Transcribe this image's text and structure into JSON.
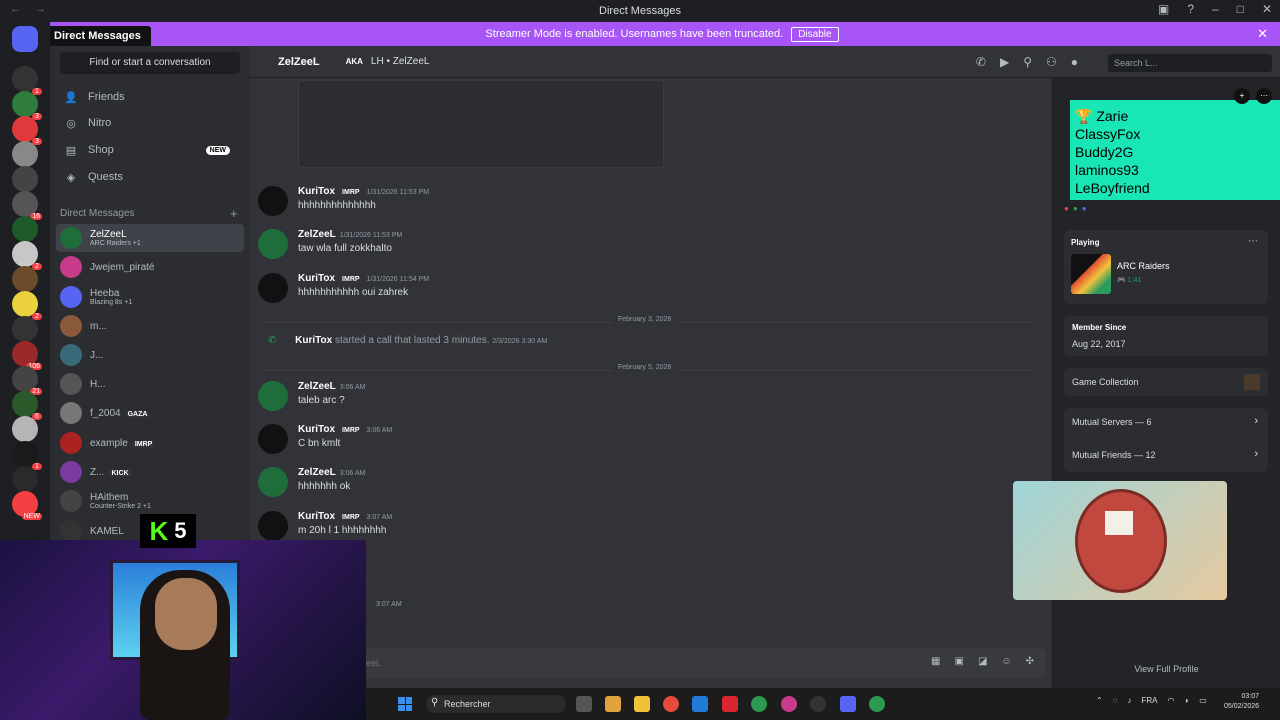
{
  "window": {
    "title": "Direct Messages"
  },
  "notice": {
    "text": "Streamer Mode is enabled. Usernames have been truncated.",
    "button": "Disable"
  },
  "tooltip": "Direct Messages",
  "sidebar": {
    "find_placeholder": "Find or start a conversation",
    "nav": [
      {
        "label": "Friends",
        "icon": "friends-icon"
      },
      {
        "label": "Nitro",
        "icon": "nitro-icon"
      },
      {
        "label": "Shop",
        "icon": "shop-icon",
        "badge": "NEW"
      },
      {
        "label": "Quests",
        "icon": "quests-icon"
      }
    ],
    "dm_header": "Direct Messages",
    "dms": [
      {
        "name": "ZelZeeL",
        "sub": "ARC Raiders +1",
        "active": true
      },
      {
        "name": "Jwejem_piraté",
        "sub": ""
      },
      {
        "name": "Heeba",
        "sub": "Blazing 8s +1"
      },
      {
        "name": "m...",
        "sub": ""
      },
      {
        "name": "J...",
        "sub": ""
      },
      {
        "name": "H...",
        "sub": ""
      },
      {
        "name": "f_2004",
        "sub": "",
        "tag": "GAZA"
      },
      {
        "name": "example",
        "sub": "",
        "tag": "IMRP"
      },
      {
        "name": "Z...",
        "sub": "",
        "tag": "KICK"
      },
      {
        "name": "HAithem",
        "sub": "Counter-Strike 2 +1"
      },
      {
        "name": "KAMEL",
        "sub": ""
      }
    ]
  },
  "servers": {
    "badges": [
      "1",
      "3",
      "3",
      "",
      "",
      "16",
      "",
      "2",
      "",
      "2",
      "",
      "106",
      "21",
      "6",
      "",
      "1",
      "",
      "NEW"
    ]
  },
  "chat_header": {
    "name": "ZelZeeL",
    "aka": "AKA",
    "aka_value": "LH • ZelZeeL",
    "search_placeholder": "Search L..."
  },
  "messages": [
    {
      "author": "KuriTox",
      "tag": "IMRP",
      "time": "1/31/2026 11:53 PM",
      "text": "hhhhhhhhhhhhhh"
    },
    {
      "author": "ZelZeeL",
      "tag": "",
      "time": "1/31/2026 11:53 PM",
      "text": "taw wla full zokkhalto"
    },
    {
      "author": "KuriTox",
      "tag": "IMRP",
      "time": "1/31/2026 11:54 PM",
      "text": "hhhhhhhhhhh oui zahrek"
    },
    {
      "author": "ZelZeeL",
      "tag": "",
      "time": "3:06 AM",
      "text": "taleb arc ?"
    },
    {
      "author": "KuriTox",
      "tag": "IMRP",
      "time": "3:06 AM",
      "text": "C bn kmlt"
    },
    {
      "author": "ZelZeeL",
      "tag": "",
      "time": "3:06 AM",
      "text": "hhhhhhh ok"
    },
    {
      "author": "KuriTox",
      "tag": "IMRP",
      "time": "3:07 AM",
      "text": "m 20h l 1 hhhhhhhh"
    }
  ],
  "dividers": [
    "February 3, 2026",
    "February 5, 2026"
  ],
  "call": {
    "author": "KuriTox",
    "text": "started a call that lasted 3 minutes.",
    "time": "2/3/2026 3:30 AM"
  },
  "late_time": "3:07 AM",
  "input": {
    "placeholder": "eeL"
  },
  "profile": {
    "banner_names": [
      "Zarie",
      "ClassyFox",
      "Buddy2G",
      "laminos93",
      "LeBoyfriend"
    ],
    "playing_label": "Playing",
    "game": "ARC Raiders",
    "game_time": "1:41",
    "member_since_label": "Member Since",
    "member_since": "Aug 22, 2017",
    "collection": "Game Collection",
    "mutual_servers": "Mutual Servers — 6",
    "mutual_friends": "Mutual Friends — 12",
    "view_full": "View Full Profile"
  },
  "stream_overlay": {
    "kick_count": "5"
  },
  "taskbar": {
    "search_placeholder": "Rechercher",
    "lang": "FRA",
    "time": "03:07",
    "date": "05/02/2026"
  }
}
